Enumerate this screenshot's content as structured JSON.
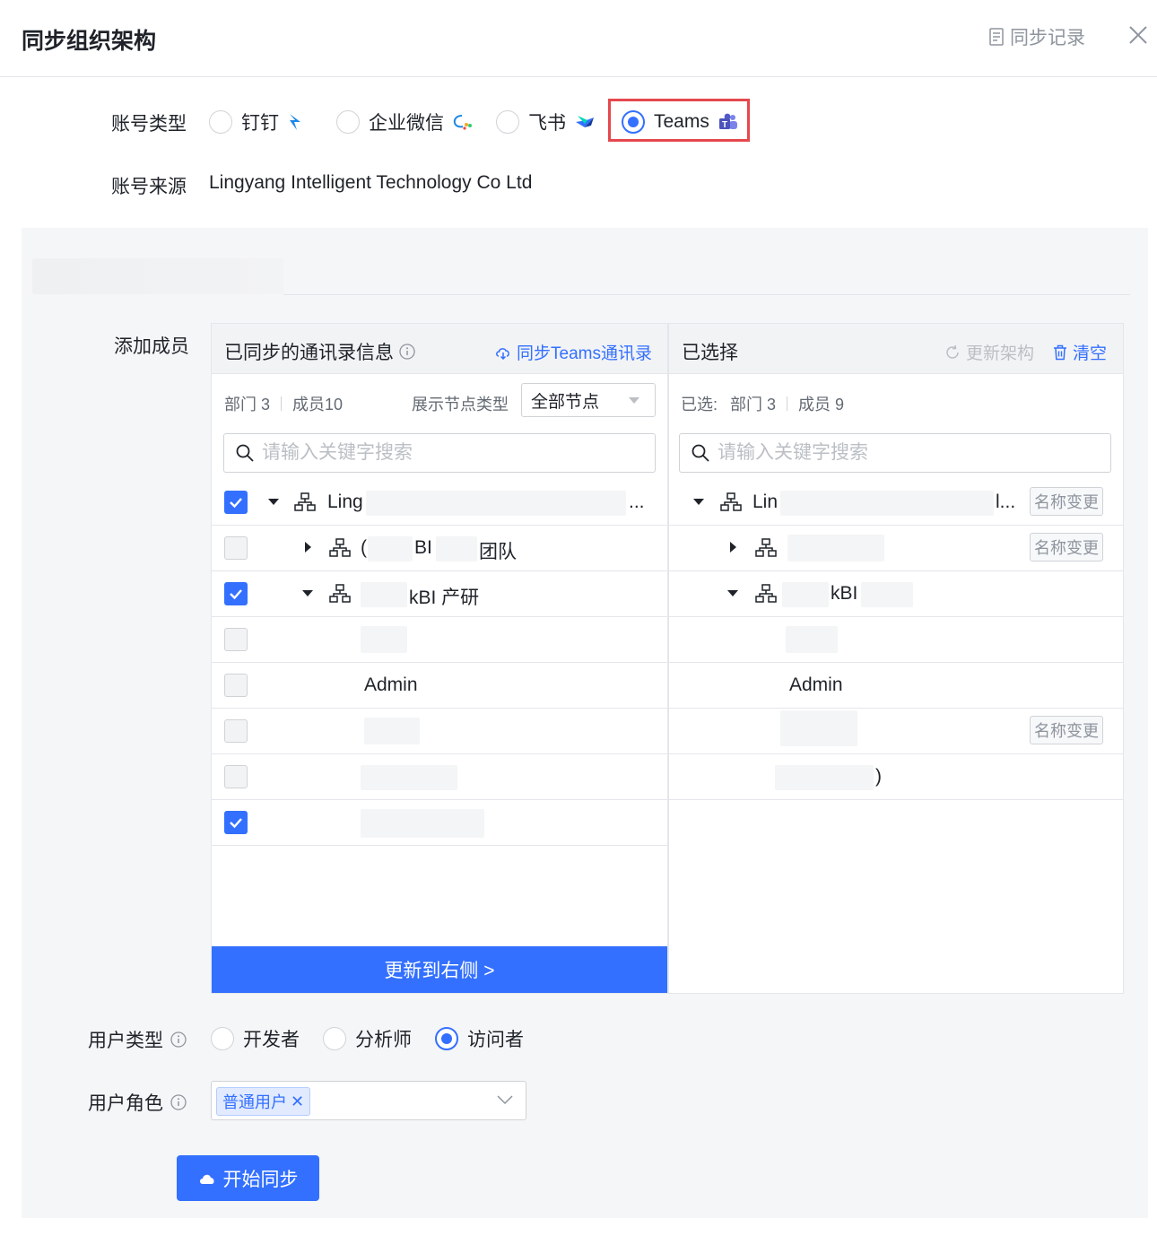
{
  "dialog": {
    "title": "同步组织架构",
    "sync_log_label": "同步记录"
  },
  "account_type": {
    "label": "账号类型",
    "options": [
      {
        "label": "钉钉",
        "checked": false,
        "icon": "dingtalk-icon"
      },
      {
        "label": "企业微信",
        "checked": false,
        "icon": "wecom-icon"
      },
      {
        "label": "飞书",
        "checked": false,
        "icon": "feishu-icon"
      },
      {
        "label": "Teams",
        "checked": true,
        "icon": "teams-icon"
      }
    ]
  },
  "account_source": {
    "label": "账号来源",
    "value": "Lingyang Intelligent Technology Co Ltd"
  },
  "add_members": {
    "label": "添加成员",
    "left_panel": {
      "title": "已同步的通讯录信息",
      "sync_link": "同步Teams通讯录",
      "dept_label": "部门 3",
      "member_label": "成员10",
      "node_type_label": "展示节点类型",
      "node_type_value": "全部节点",
      "search_placeholder": "请输入关键字搜索",
      "rows": [
        {
          "text": "Ling",
          "suffix": "...",
          "checked": true,
          "caret": "down",
          "org": true
        },
        {
          "text": "(",
          "mid": "BI",
          "end": "团队",
          "checked": false,
          "caret": "right",
          "org": true
        },
        {
          "text": "kBI 产研",
          "checked": true,
          "caret": "down",
          "org": true
        },
        {
          "text": "",
          "checked": false
        },
        {
          "text": "Admin",
          "checked": false
        },
        {
          "text": "",
          "checked": false
        },
        {
          "text": "",
          "checked": false
        },
        {
          "text": "",
          "checked": true
        }
      ],
      "update_button": "更新到右侧 >"
    },
    "right_panel": {
      "title": "已选择",
      "refresh_label": "更新架构",
      "clear_label": "清空",
      "selected_label": "已选:",
      "dept_label": "部门 3",
      "member_label": "成员 9",
      "search_placeholder": "请输入关键字搜索",
      "rows": [
        {
          "text": "Lin",
          "suffix": "l...",
          "tag": "名称变更"
        },
        {
          "text": "",
          "tag": "名称变更"
        },
        {
          "text": "kBI",
          "tag": ""
        },
        {
          "text": "",
          "tag": ""
        },
        {
          "text": "Admin",
          "tag": ""
        },
        {
          "text": "",
          "tag": "名称变更"
        },
        {
          "text": ")",
          "tag": ""
        }
      ]
    }
  },
  "user_type": {
    "label": "用户类型",
    "options": [
      {
        "label": "开发者",
        "checked": false
      },
      {
        "label": "分析师",
        "checked": false
      },
      {
        "label": "访问者",
        "checked": true
      }
    ]
  },
  "user_role": {
    "label": "用户角色",
    "selected": "普通用户"
  },
  "start_button": "开始同步",
  "colors": {
    "accent": "#3370ff",
    "highlight": "#e5484d"
  }
}
